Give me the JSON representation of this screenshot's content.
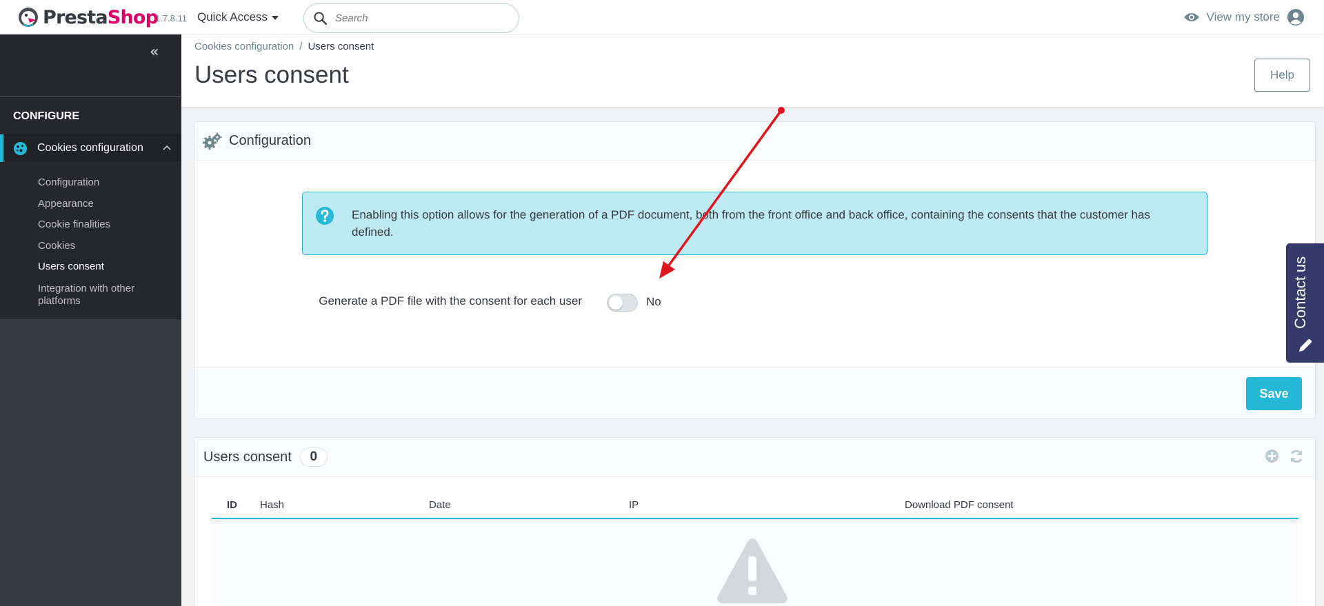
{
  "header": {
    "logo_part1": "Presta",
    "logo_part2": "Shop",
    "version": "1.7.8.11",
    "quick_access": "Quick Access",
    "search_placeholder": "Search",
    "view_store": "View my store"
  },
  "sidebar": {
    "section_title": "CONFIGURE",
    "menu_head": "Cookies configuration",
    "items": [
      {
        "label": "Configuration"
      },
      {
        "label": "Appearance"
      },
      {
        "label": "Cookie finalities"
      },
      {
        "label": "Cookies"
      },
      {
        "label": "Users consent",
        "active": true
      },
      {
        "label": "Integration with other platforms"
      }
    ]
  },
  "page": {
    "breadcrumb_parent": "Cookies configuration",
    "breadcrumb_separator": "/",
    "breadcrumb_current": "Users consent",
    "title": "Users consent",
    "help_label": "Help"
  },
  "config_panel": {
    "heading": "Configuration",
    "alert_text": "Enabling this option allows for the generation of a PDF document, both from the front office and back office, containing the consents that the customer has defined.",
    "field_label": "Generate a PDF file with the consent for each user",
    "switch_value": "No",
    "switch_on": false,
    "save_label": "Save"
  },
  "list_panel": {
    "heading": "Users consent",
    "count": "0",
    "columns": [
      "ID",
      "Hash",
      "Date",
      "IP",
      "Download PDF consent"
    ]
  },
  "contact_tab": {
    "label": "Contact us"
  },
  "colors": {
    "accent": "#25b9d7",
    "brand_pink": "#df0067",
    "sidebar_bg": "#363a41",
    "annotation_arrow": "#e0141c"
  },
  "icons": {
    "search": "search-icon",
    "view_store": "eye-icon",
    "user": "user-circle-icon",
    "collapse": "double-chevron-left-icon",
    "cookie": "cookie-icon",
    "gears": "gears-icon",
    "help": "question-circle-icon",
    "add": "plus-circle-icon",
    "refresh": "refresh-icon",
    "warning": "warning-triangle-icon",
    "pencil": "pencil-icon"
  }
}
